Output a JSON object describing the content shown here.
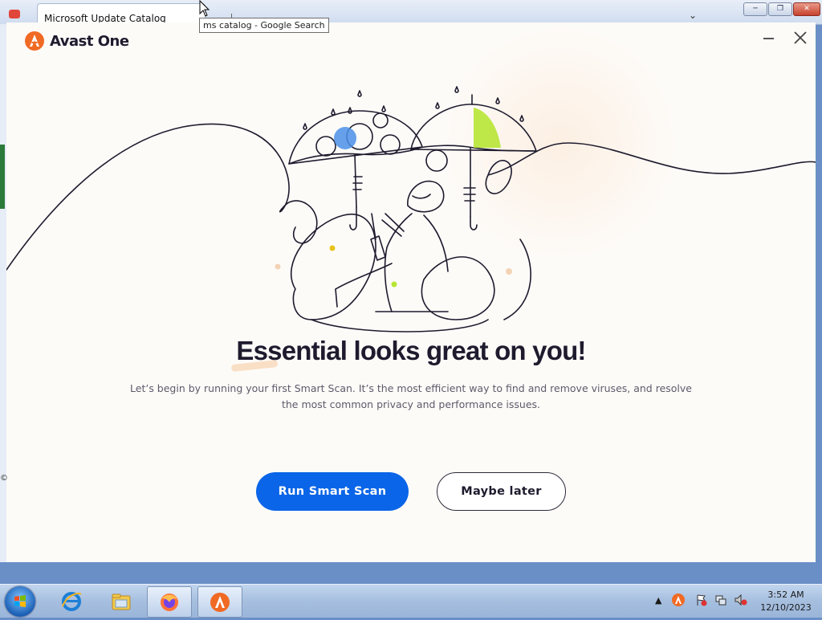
{
  "browser": {
    "tab_title": "Microsoft Update Catalog",
    "tooltip": "ms catalog - Google Search"
  },
  "avast": {
    "brand": "Avast One",
    "headline": "Essential looks great on you!",
    "subtext": "Let’s begin by running your first Smart Scan. It’s the most efficient way to find and remove viruses, and resolve the most common privacy and performance issues.",
    "primary_button": "Run Smart Scan",
    "secondary_button": "Maybe later",
    "accent_color": "#0a65e8",
    "brand_color": "#f06a24"
  },
  "taskbar": {
    "items": [
      "start-button",
      "internet-explorer-icon",
      "file-explorer-icon",
      "firefox-icon",
      "avast-icon"
    ],
    "clock_time": "3:52 AM",
    "clock_date": "12/10/2023"
  }
}
